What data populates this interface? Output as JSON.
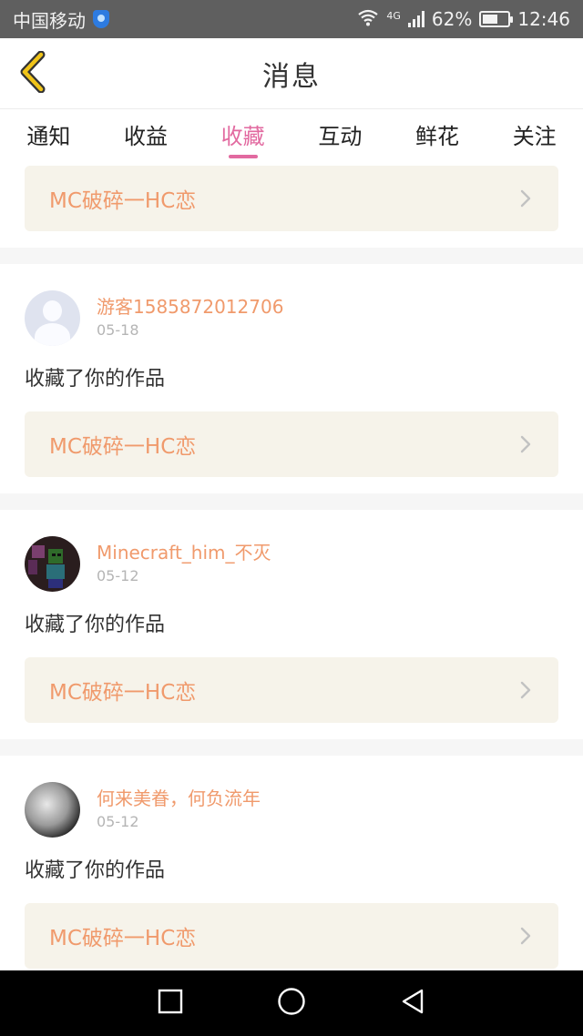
{
  "status_bar": {
    "carrier": "中国移动",
    "network": "4G",
    "battery": "62%",
    "battery_level": 0.62,
    "time": "12:46",
    "icons": [
      "shield-icon",
      "wifi-icon",
      "signal-icon",
      "battery-icon"
    ]
  },
  "header": {
    "title": "消息",
    "back_icon": "chevron-left-icon",
    "accent_color": "#f0c419"
  },
  "tabs": [
    {
      "label": "通知",
      "active": false
    },
    {
      "label": "收益",
      "active": false
    },
    {
      "label": "收藏",
      "active": true
    },
    {
      "label": "互动",
      "active": false
    },
    {
      "label": "鲜花",
      "active": false
    },
    {
      "label": "关注",
      "active": false
    }
  ],
  "colors": {
    "active_tab": "#e26aa0",
    "username": "#f09a6c",
    "work_bg": "#f6f3ea"
  },
  "feed": {
    "partial_item": {
      "work_title": "MC破碎一HC恋"
    },
    "items": [
      {
        "username": "游客1585872012706",
        "date": "05-18",
        "action": "收藏了你的作品",
        "work_title": "MC破碎一HC恋"
      },
      {
        "username": "Minecraft_him_不灭",
        "date": "05-12",
        "action": "收藏了你的作品",
        "work_title": "MC破碎一HC恋"
      },
      {
        "username": "何来美眷，何负流年",
        "date": "05-12",
        "action": "收藏了你的作品",
        "work_title": "MC破碎一HC恋"
      }
    ]
  },
  "nav_bar": {
    "icons": [
      "recent-apps-icon",
      "home-icon",
      "back-icon"
    ]
  }
}
